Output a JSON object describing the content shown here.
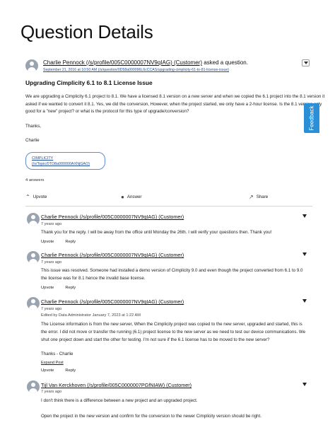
{
  "page_title": "Question Details",
  "question": {
    "author_name": "Charlie Pennock (/s/profile/005C0000007NV9qIAG) (Customer)",
    "author_suffix": " asked a question.",
    "date_link": "September 21, 2016 at 10:50 AM (/s/question/0D58a000096L6cCCAS/upgrading-cimplicity-61-to-81-license-issue)",
    "title": "Upgrading Cimplicity 6.1 to 8.1 License Issue",
    "body_p1": "We are upgrading a Cimplicity 6.1 project to 8.1. We have a licensed 8.1 version on a new server and when we copied the 6.1 project into the 8.1 version it asked if we wanted to convert it 8.1. Yes, we did the conversion, However, when the project started, we only have a 2-hour license. Is the 8.1 version only good for a \"new\" project? or what is the protocol for this type of upgrade/conversion?",
    "body_p2": "Thanks,",
    "body_p3": "Charlie",
    "topic_line1": "CIMPLICITY",
    "topic_line2": "(/s/Topic/0TO8a000000AXNjGAO)",
    "answer_count": "4 answers"
  },
  "actions": {
    "upvote": "Upvote",
    "answer": "Answer",
    "share": "Share"
  },
  "feedback_label": "Feedback",
  "answers": [
    {
      "author": "Charlie Pennock (/s/profile/005C0000007NV9qIAG) (Customer)",
      "time": "7 years ago",
      "text": "Thank you for the reply. I will be away from the office until Monday the 26th. I will verify your questions then. Thank you!",
      "upvote": "Upvote",
      "reply": "Reply"
    },
    {
      "author": "Charlie Pennock (/s/profile/005C0000007NV9qIAG) (Customer)",
      "time": "7 years ago",
      "text": "This issue was resolved. Someone had installed a demo version of Cimplicity 9.0 and even though the project converted from 6.1 to 9.0 the license was for 8.1 hence the invalid base license.",
      "upvote": "Upvote",
      "reply": "Reply"
    },
    {
      "author": "Charlie Pennock (/s/profile/005C0000007NV9qIAG) (Customer)",
      "time": "7 years ago",
      "edited": "Edited by Data Administrator January 7, 2023 at 1:22 AM",
      "text": "The License information is from the new server, When the Cimplicity project was copied to the new server, upgraded and started, this is the error. I did not move or transfer the running (6.1) project license to the new server as we need to test our device communications. We shut one project down and start the other for testing. I'm not sure if the 6.1 license has to be moved to the new server?",
      "signoff": "Thanks - Charlie",
      "expand": "Expand Post",
      "upvote": "Upvote",
      "reply": "Reply"
    },
    {
      "author": "Tijl Van Kerckhoven (/s/profile/005C0000007PGfNIAW) (Customer)",
      "time": "7 years ago",
      "text": "I don't think there is a difference between a new project and an upgraded project.",
      "text2": "Open the project in the new version and confirm for the conversion to the newer Cimplicity version should be right."
    }
  ]
}
